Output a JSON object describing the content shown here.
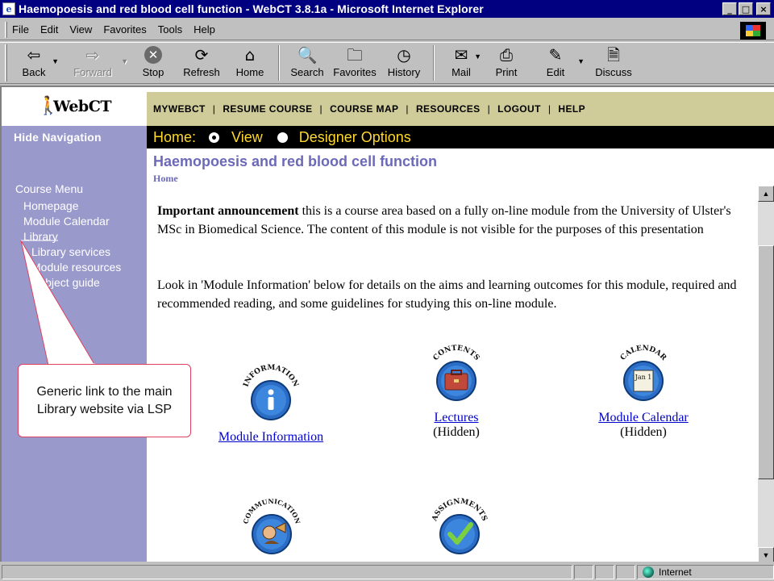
{
  "window": {
    "title": "Haemopoesis and red blood cell function - WebCT 3.8.1a - Microsoft Internet Explorer",
    "app_icon": "ie-page-icon",
    "min_glyph": "_",
    "max_glyph": "□",
    "close_glyph": "×"
  },
  "menubar": {
    "items": [
      "File",
      "Edit",
      "View",
      "Favorites",
      "Tools",
      "Help"
    ]
  },
  "toolbar": {
    "back": "Back",
    "forward": "Forward",
    "stop": "Stop",
    "refresh": "Refresh",
    "home": "Home",
    "search": "Search",
    "favorites": "Favorites",
    "history": "History",
    "mail": "Mail",
    "print": "Print",
    "edit": "Edit",
    "discuss": "Discuss"
  },
  "webct": {
    "logo_text": "WebCT",
    "topnav": [
      "MYWEBCT",
      "RESUME COURSE",
      "COURSE MAP",
      "RESOURCES",
      "LOGOUT",
      "HELP"
    ],
    "nav_separator": "|",
    "hide_navigation": "Hide Navigation",
    "homebar": {
      "home_label": "Home:",
      "view_label": "View",
      "designer_label": "Designer Options",
      "selected": "View"
    },
    "course_title": "Haemopoesis and red blood cell function",
    "breadcrumb": "Home"
  },
  "sidebar": {
    "course_menu": "Course Menu",
    "items": [
      {
        "label": "Homepage"
      },
      {
        "label": "Module Calendar"
      },
      {
        "label": "Library"
      },
      {
        "label": "Library services"
      },
      {
        "label": "Module resources"
      },
      {
        "label": "Subject guide"
      }
    ]
  },
  "announcement": {
    "bold_lead": "Important announcement",
    "rest": " this is a course area based on a fully on-line module from the University of Ulster's MSc in Biomedical Science. The content of this module is not visible for the purposes of this presentation",
    "para2": "Look in 'Module Information' below for details on the aims and learning outcomes for this module, required and recommended reading, and some guidelines for studying this on-line module."
  },
  "tools": [
    {
      "label": "Module Information",
      "status": "",
      "badge_text": "INFORMATION"
    },
    {
      "label": "Lectures",
      "status": "(Hidden)",
      "badge_text": "CONTENTS"
    },
    {
      "label": "Module Calendar",
      "status": "(Hidden)",
      "badge_text": "CALENDAR",
      "cal_text": "Jan 1"
    },
    {
      "label": "",
      "status": "",
      "badge_text": "COMMUNICATION"
    },
    {
      "label": "",
      "status": "",
      "badge_text": "ASSIGNMENTS"
    }
  ],
  "statusbar": {
    "zone": "Internet"
  },
  "callout": {
    "text": "Generic link to the main Library website via LSP"
  },
  "colors": {
    "titlebar": "#000080",
    "sidebar": "#9999cc",
    "topnav": "#cfcc9a",
    "homebar_text": "#ffd830",
    "course_title": "#6b69b8",
    "link": "#0000cc",
    "callout_border": "#e04060"
  }
}
